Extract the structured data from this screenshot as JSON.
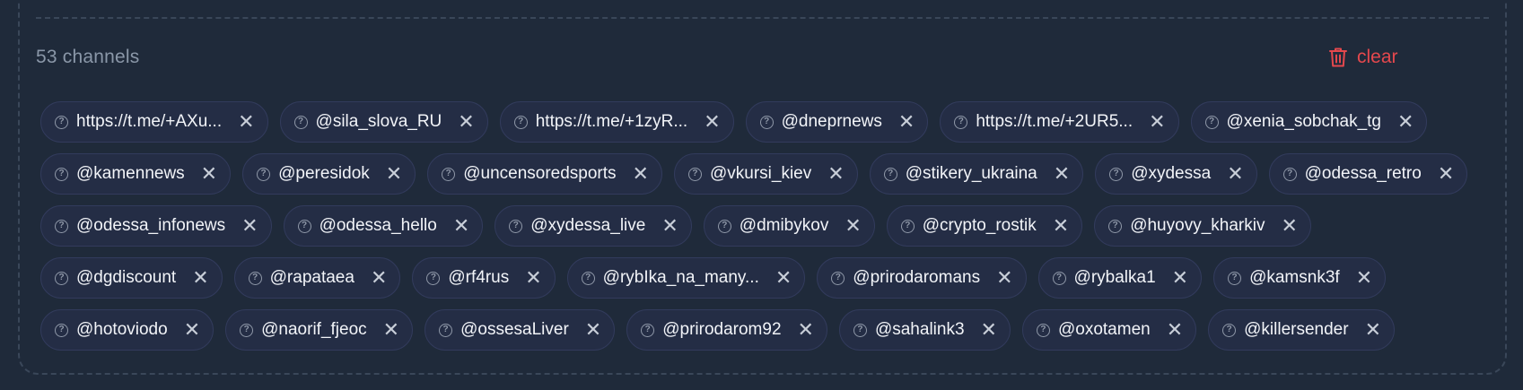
{
  "header": {
    "count_label": "53 channels",
    "clear_label": "clear",
    "clear_icon": "trash-icon",
    "accent_color": "#e5484d"
  },
  "chips": [
    {
      "label": "https://t.me/+AXu...",
      "icon": "help-circle-icon"
    },
    {
      "label": "@sila_slova_RU",
      "icon": "help-circle-icon"
    },
    {
      "label": "https://t.me/+1zyR...",
      "icon": "help-circle-icon"
    },
    {
      "label": "@dneprnews",
      "icon": "help-circle-icon"
    },
    {
      "label": "https://t.me/+2UR5...",
      "icon": "help-circle-icon"
    },
    {
      "label": "@xenia_sobchak_tg",
      "icon": "help-circle-icon"
    },
    {
      "label": "@kamennews",
      "icon": "help-circle-icon"
    },
    {
      "label": "@peresidok",
      "icon": "help-circle-icon"
    },
    {
      "label": "@uncensoredsports",
      "icon": "help-circle-icon"
    },
    {
      "label": "@vkursi_kiev",
      "icon": "help-circle-icon"
    },
    {
      "label": "@stikery_ukraina",
      "icon": "help-circle-icon"
    },
    {
      "label": "@xydessa",
      "icon": "help-circle-icon"
    },
    {
      "label": "@odessa_retro",
      "icon": "help-circle-icon"
    },
    {
      "label": "@odessa_infonews",
      "icon": "help-circle-icon"
    },
    {
      "label": "@odessa_hello",
      "icon": "help-circle-icon"
    },
    {
      "label": "@xydessa_live",
      "icon": "help-circle-icon"
    },
    {
      "label": "@dmibykov",
      "icon": "help-circle-icon"
    },
    {
      "label": "@crypto_rostik",
      "icon": "help-circle-icon"
    },
    {
      "label": "@huyovy_kharkiv",
      "icon": "help-circle-icon"
    },
    {
      "label": "@dgdiscount",
      "icon": "help-circle-icon"
    },
    {
      "label": "@rapataea",
      "icon": "help-circle-icon"
    },
    {
      "label": "@rf4rus",
      "icon": "help-circle-icon"
    },
    {
      "label": "@rybIka_na_many...",
      "icon": "help-circle-icon"
    },
    {
      "label": "@prirodaromans",
      "icon": "help-circle-icon"
    },
    {
      "label": "@rybalka1",
      "icon": "help-circle-icon"
    },
    {
      "label": "@kamsnk3f",
      "icon": "help-circle-icon"
    },
    {
      "label": "@hotoviodo",
      "icon": "help-circle-icon"
    },
    {
      "label": "@naorif_fjeoc",
      "icon": "help-circle-icon"
    },
    {
      "label": "@ossesaLiver",
      "icon": "help-circle-icon"
    },
    {
      "label": "@prirodarom92",
      "icon": "help-circle-icon"
    },
    {
      "label": "@sahalink3",
      "icon": "help-circle-icon"
    },
    {
      "label": "@oxotamen",
      "icon": "help-circle-icon"
    },
    {
      "label": "@killersender",
      "icon": "help-circle-icon"
    }
  ]
}
